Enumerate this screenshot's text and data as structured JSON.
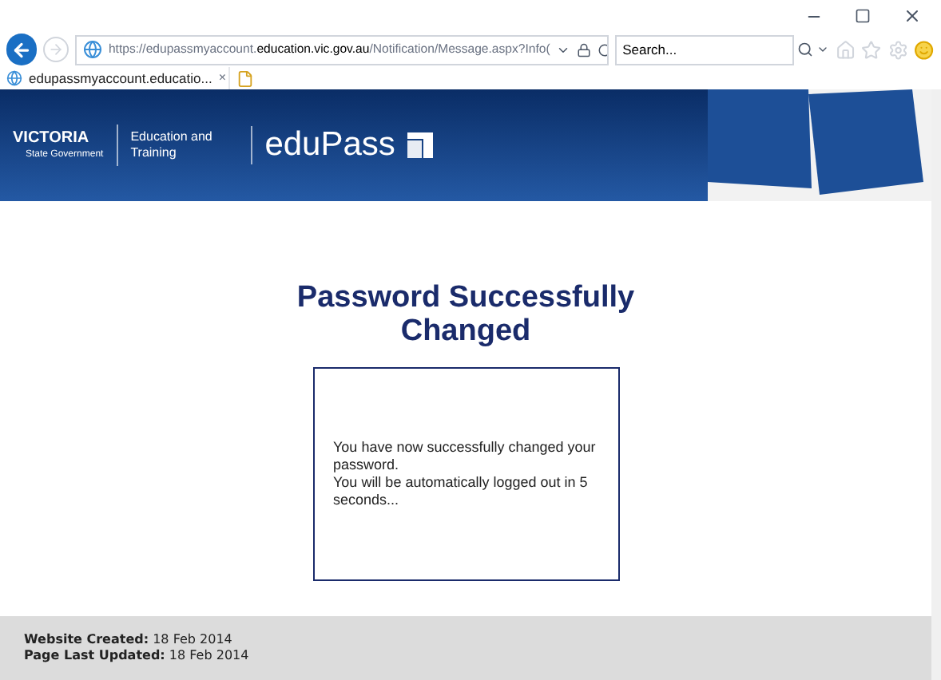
{
  "browser": {
    "url_prefix": "https://edupassmyaccount.",
    "url_domain": "education.vic.gov.au",
    "url_path": "/Notification/Message.aspx?Info(",
    "search": {
      "placeholder": "Search..."
    },
    "tab": {
      "title": "edupassmyaccount.educatio...",
      "close": "×"
    }
  },
  "banner": {
    "logo_word": "VICTORIA",
    "logo_sub": "State Government",
    "department": "Education and Training",
    "product": "eduPass"
  },
  "message": {
    "heading": "Password Successfully Changed",
    "body": [
      "You have now successfully changed your password.",
      "You will be automatically logged out in 5 seconds..."
    ]
  },
  "footer": [
    "**Website Created:** 18 Feb 2014",
    "**Page Last Updated:** 18 Feb 2014"
  ]
}
